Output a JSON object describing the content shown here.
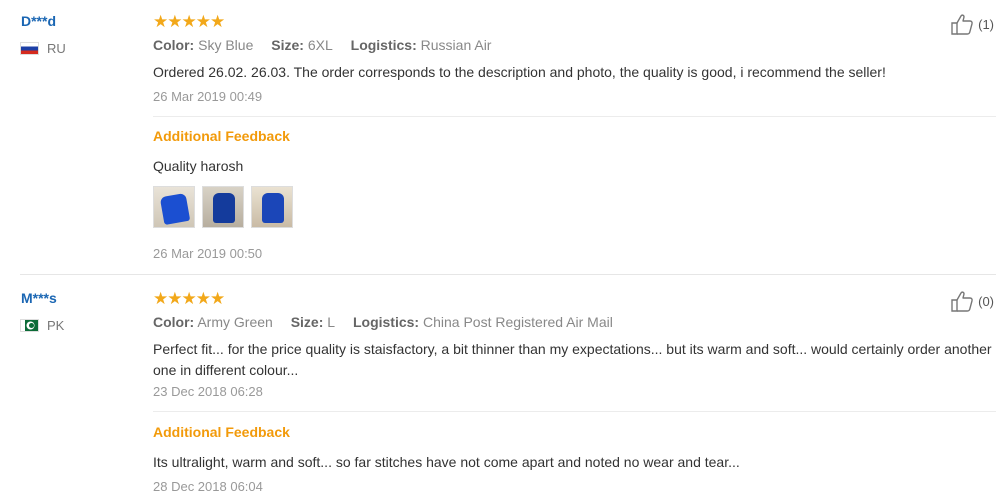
{
  "reviews": [
    {
      "user": "D***d",
      "country": "RU",
      "stars": "★★★★★",
      "rating": 5,
      "likes": "(1)",
      "meta": [
        {
          "label": "Color:",
          "value": "Sky Blue"
        },
        {
          "label": "Size:",
          "value": "6XL"
        },
        {
          "label": "Logistics:",
          "value": "Russian Air"
        }
      ],
      "text": "Ordered 26.02. 26.03. The order corresponds to the description and photo, the quality is good, i recommend the seller!",
      "date": "26 Mar 2019 00:49",
      "additional": {
        "title": "Additional Feedback",
        "text": "Quality harosh",
        "date": "26 Mar 2019 00:50",
        "photo_count": 3
      }
    },
    {
      "user": "M***s",
      "country": "PK",
      "stars": "★★★★★",
      "rating": 5,
      "likes": "(0)",
      "meta": [
        {
          "label": "Color:",
          "value": "Army Green"
        },
        {
          "label": "Size:",
          "value": "L"
        },
        {
          "label": "Logistics:",
          "value": "China Post Registered Air Mail"
        }
      ],
      "text": "Perfect fit... for the price quality is staisfactory, a bit thinner than my expectations... but its warm and soft... would certainly order another one in different colour...",
      "date": "23 Dec 2018 06:28",
      "additional": {
        "title": "Additional Feedback",
        "text": "Its ultralight, warm and soft... so far stitches have not come apart and noted no wear and tear...",
        "date": "28 Dec 2018 06:04"
      }
    }
  ],
  "colors": {
    "user_name": "#1a66b3",
    "star": "#f2a81a",
    "additional_title": "#f29a0a"
  }
}
